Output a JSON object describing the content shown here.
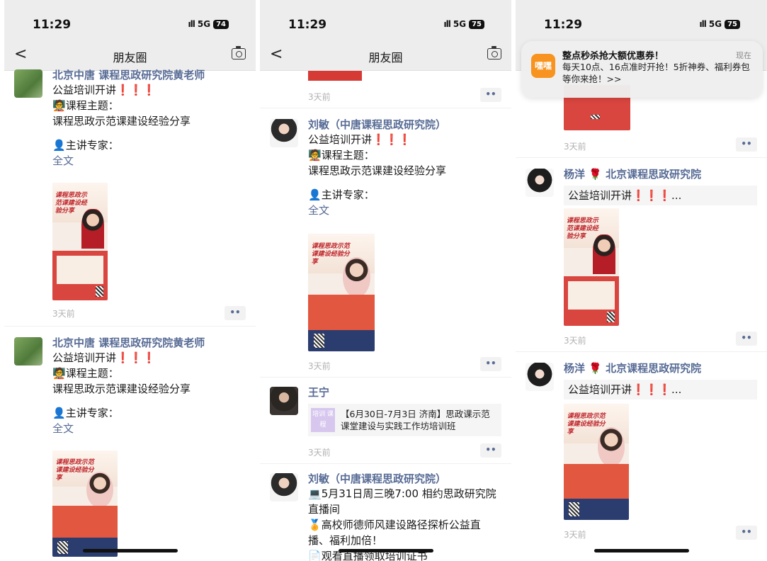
{
  "status": {
    "time": "11:29",
    "signal": "5G",
    "battery": [
      "74",
      "75",
      "75"
    ]
  },
  "nav": {
    "back": "<",
    "title": "朋友圈"
  },
  "common": {
    "line1": "公益培训开讲",
    "excl": "❗❗❗",
    "topic": "课程主题：",
    "topic_icon": "🧑‍🏫",
    "topic_text": "课程思政示范课建设经验分享",
    "speaker": "主讲专家：",
    "full_text": "全文",
    "ago": "3天前",
    "more": "••",
    "collapsed_text": "公益培训开讲",
    "ellipsis": "..."
  },
  "names": {
    "huang": "北京中唐 课程思政研究院黄老师",
    "liumin": "刘敏（中唐课程思政研究院）",
    "wangning": "王宁",
    "yangyang": "杨洋",
    "yangyang_org": "北京课程思政研究院"
  },
  "link_card": {
    "icon_text": "培训 课程",
    "title": "【6月30日-7月3日 济南】思政课示范课堂建设与实践工作坊培训班"
  },
  "post_live": {
    "line1": "5月31日周三晚7:00 相约思政研究院直播间",
    "line2": "高校师德师风建设路径探析公益直播、福利加倍！",
    "line3": "观看直播领取培训证书"
  },
  "poster": {
    "title_a": "课程思政示范课建设经验分享",
    "title_b": "课程思政示范课建设经验分享"
  },
  "notification": {
    "app_icon": "嘿嘿",
    "title": "整点秒杀抢大额优惠券！",
    "time": "现在",
    "text": "每天10点、16点准时开抢！5折神券、福利券包等你来抢！>>"
  }
}
